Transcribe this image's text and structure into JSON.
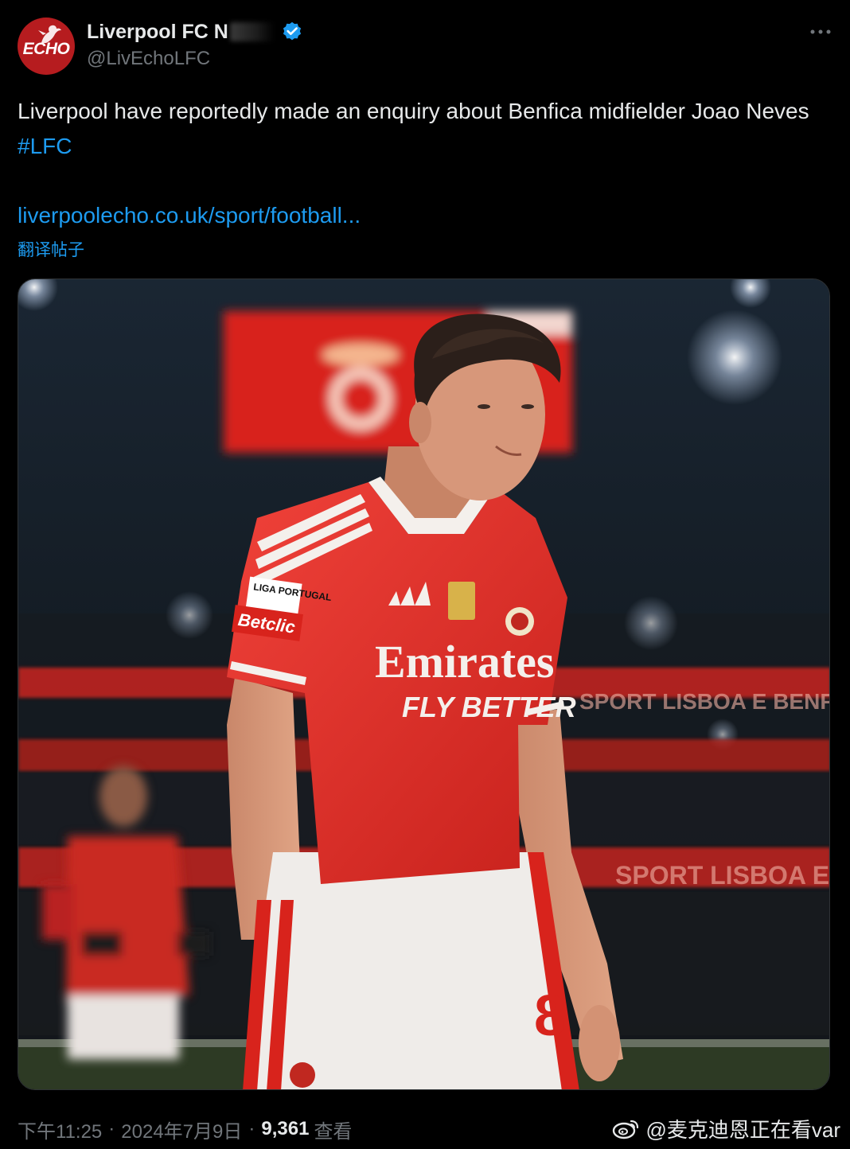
{
  "author": {
    "avatar_text": "ECHO",
    "display_name": "Liverpool FC N",
    "handle": "@LivEchoLFC",
    "avatar_color": "#b61c1f",
    "verified_color": "#1d9bf0"
  },
  "tweet": {
    "text": "Liverpool have reportedly made an enquiry about Benfica midfielder Joao Neves ",
    "hashtag": "#LFC",
    "link": "liverpoolecho.co.uk/sport/football...",
    "translate_label": "翻译帖子"
  },
  "media": {
    "shirt_sponsor": "Emirates",
    "shirt_slogan": "FLY BETTER",
    "sleeve_badge": "LIGA PORTUGAL",
    "sleeve_sponsor": "Betclic",
    "shirt_number": "8",
    "board_text": "SPORT LISBOA E BENFICA"
  },
  "footer": {
    "time": "下午11:25",
    "separator": "·",
    "date": "2024年7月9日",
    "views_count": "9,361",
    "views_label": "查看"
  },
  "watermark": {
    "text": "@麦克迪恩正在看var",
    "icon": "weibo-icon"
  },
  "colors": {
    "background": "#000000",
    "text_primary": "#e7e9ea",
    "text_secondary": "#71767b",
    "link": "#1d9bf0"
  }
}
